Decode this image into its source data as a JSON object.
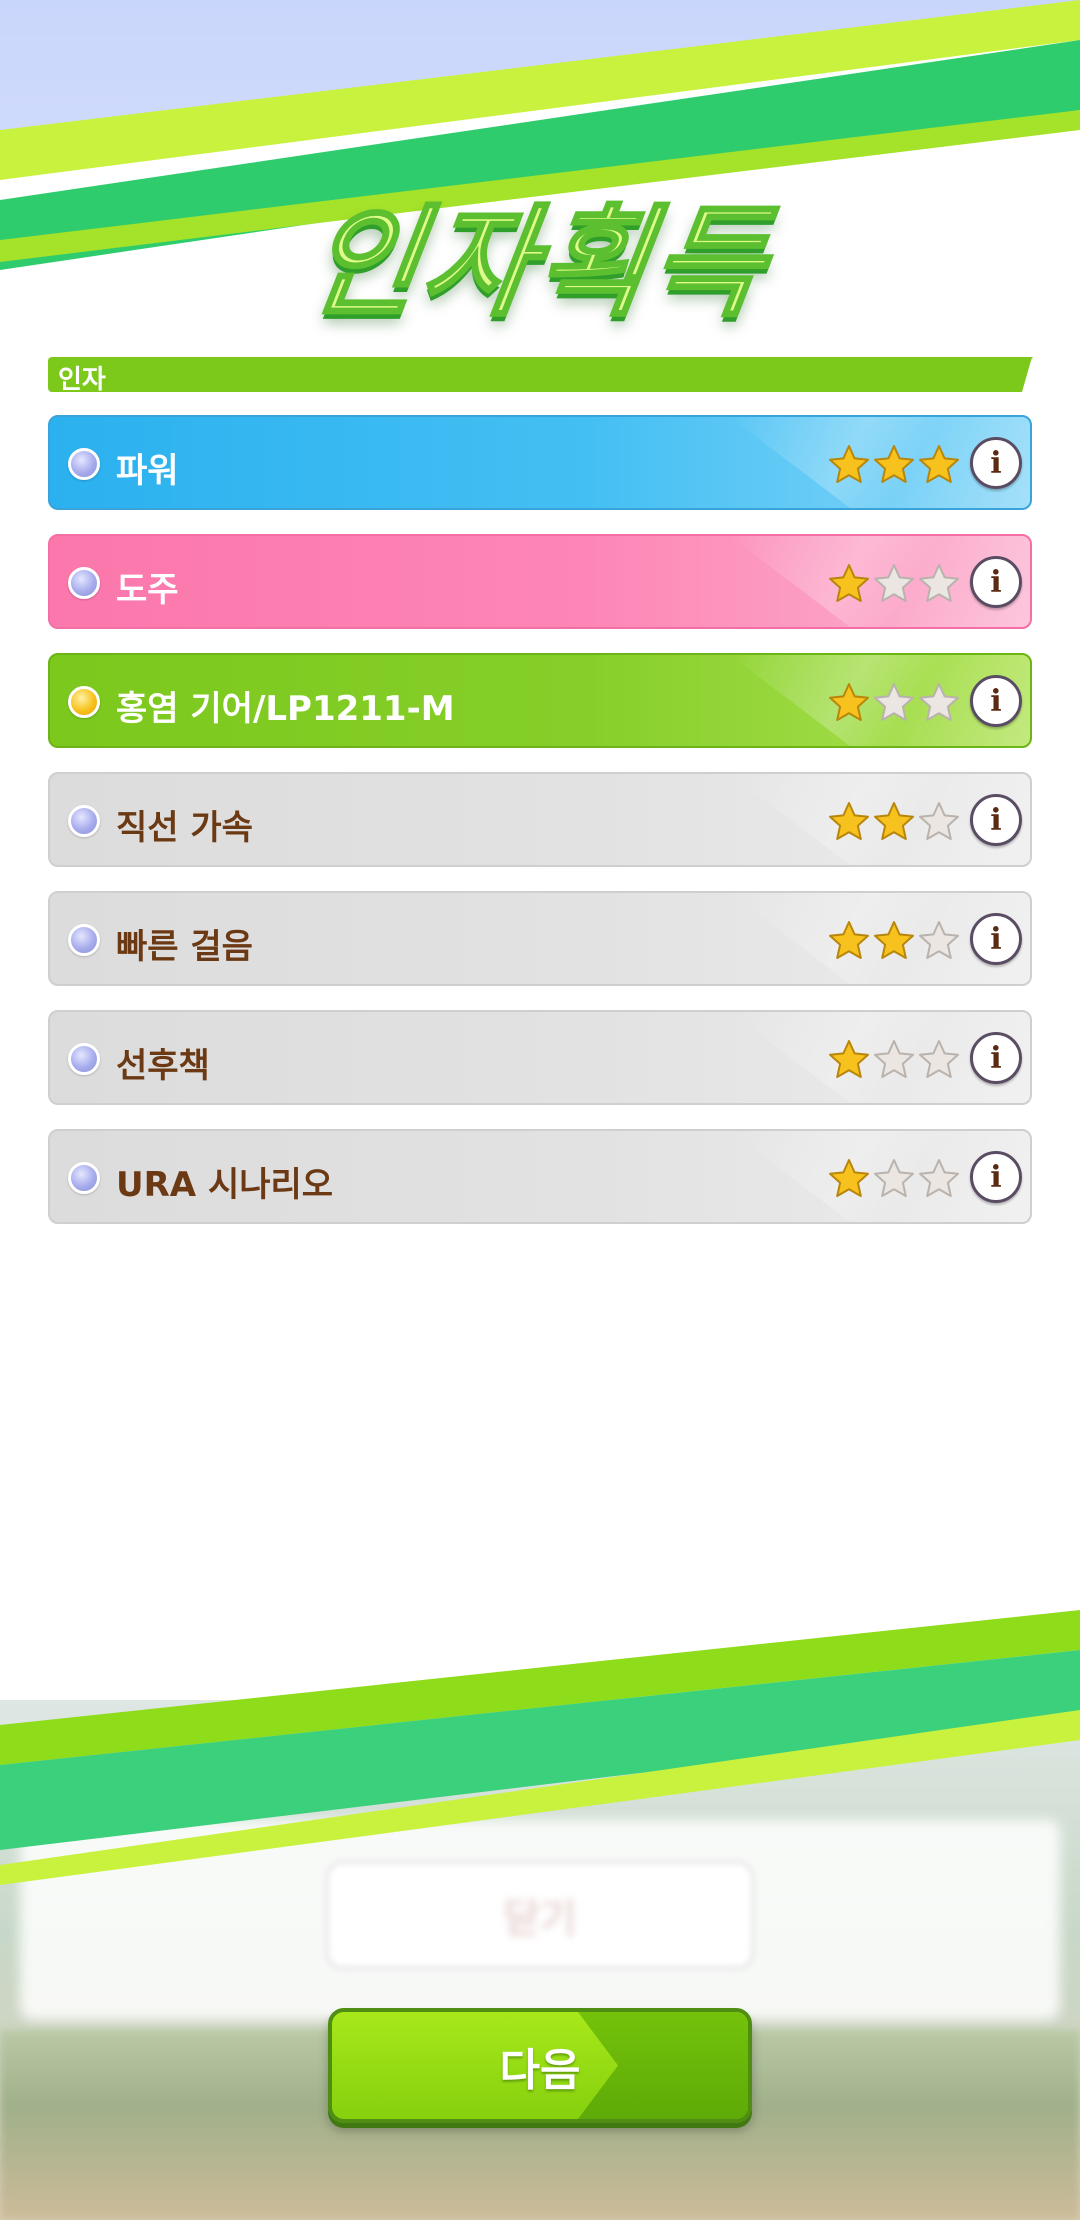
{
  "title": "인자획득",
  "section": {
    "label": "인자"
  },
  "items": [
    {
      "name": "파워",
      "style": "blue",
      "dot": "blue-orb",
      "stars": 3,
      "max_stars": 3
    },
    {
      "name": "도주",
      "style": "pink",
      "dot": "blue-orb",
      "stars": 1,
      "max_stars": 3
    },
    {
      "name": "홍염 기어/LP1211-M",
      "style": "green",
      "dot": "gold-orb",
      "stars": 1,
      "max_stars": 3
    },
    {
      "name": "직선 가속",
      "style": "gray",
      "dot": "blue-orb",
      "stars": 2,
      "max_stars": 3
    },
    {
      "name": "빠른 걸음",
      "style": "gray",
      "dot": "blue-orb",
      "stars": 2,
      "max_stars": 3
    },
    {
      "name": "선후책",
      "style": "gray",
      "dot": "blue-orb",
      "stars": 1,
      "max_stars": 3
    },
    {
      "name": "URA 시나리오",
      "style": "gray",
      "dot": "blue-orb",
      "stars": 1,
      "max_stars": 3
    }
  ],
  "info_icon_glyph": "i",
  "next_button": {
    "label": "다음"
  },
  "background_button": {
    "label": "닫기"
  },
  "colors": {
    "accent_green": "#7cc91c",
    "blue_item": "#2bb1ef",
    "pink_item": "#fb77ac",
    "green_item": "#7cc81d",
    "gray_item": "#dcdcdc",
    "star_gold": "#f7c21d",
    "gray_text": "#6b3a14"
  }
}
